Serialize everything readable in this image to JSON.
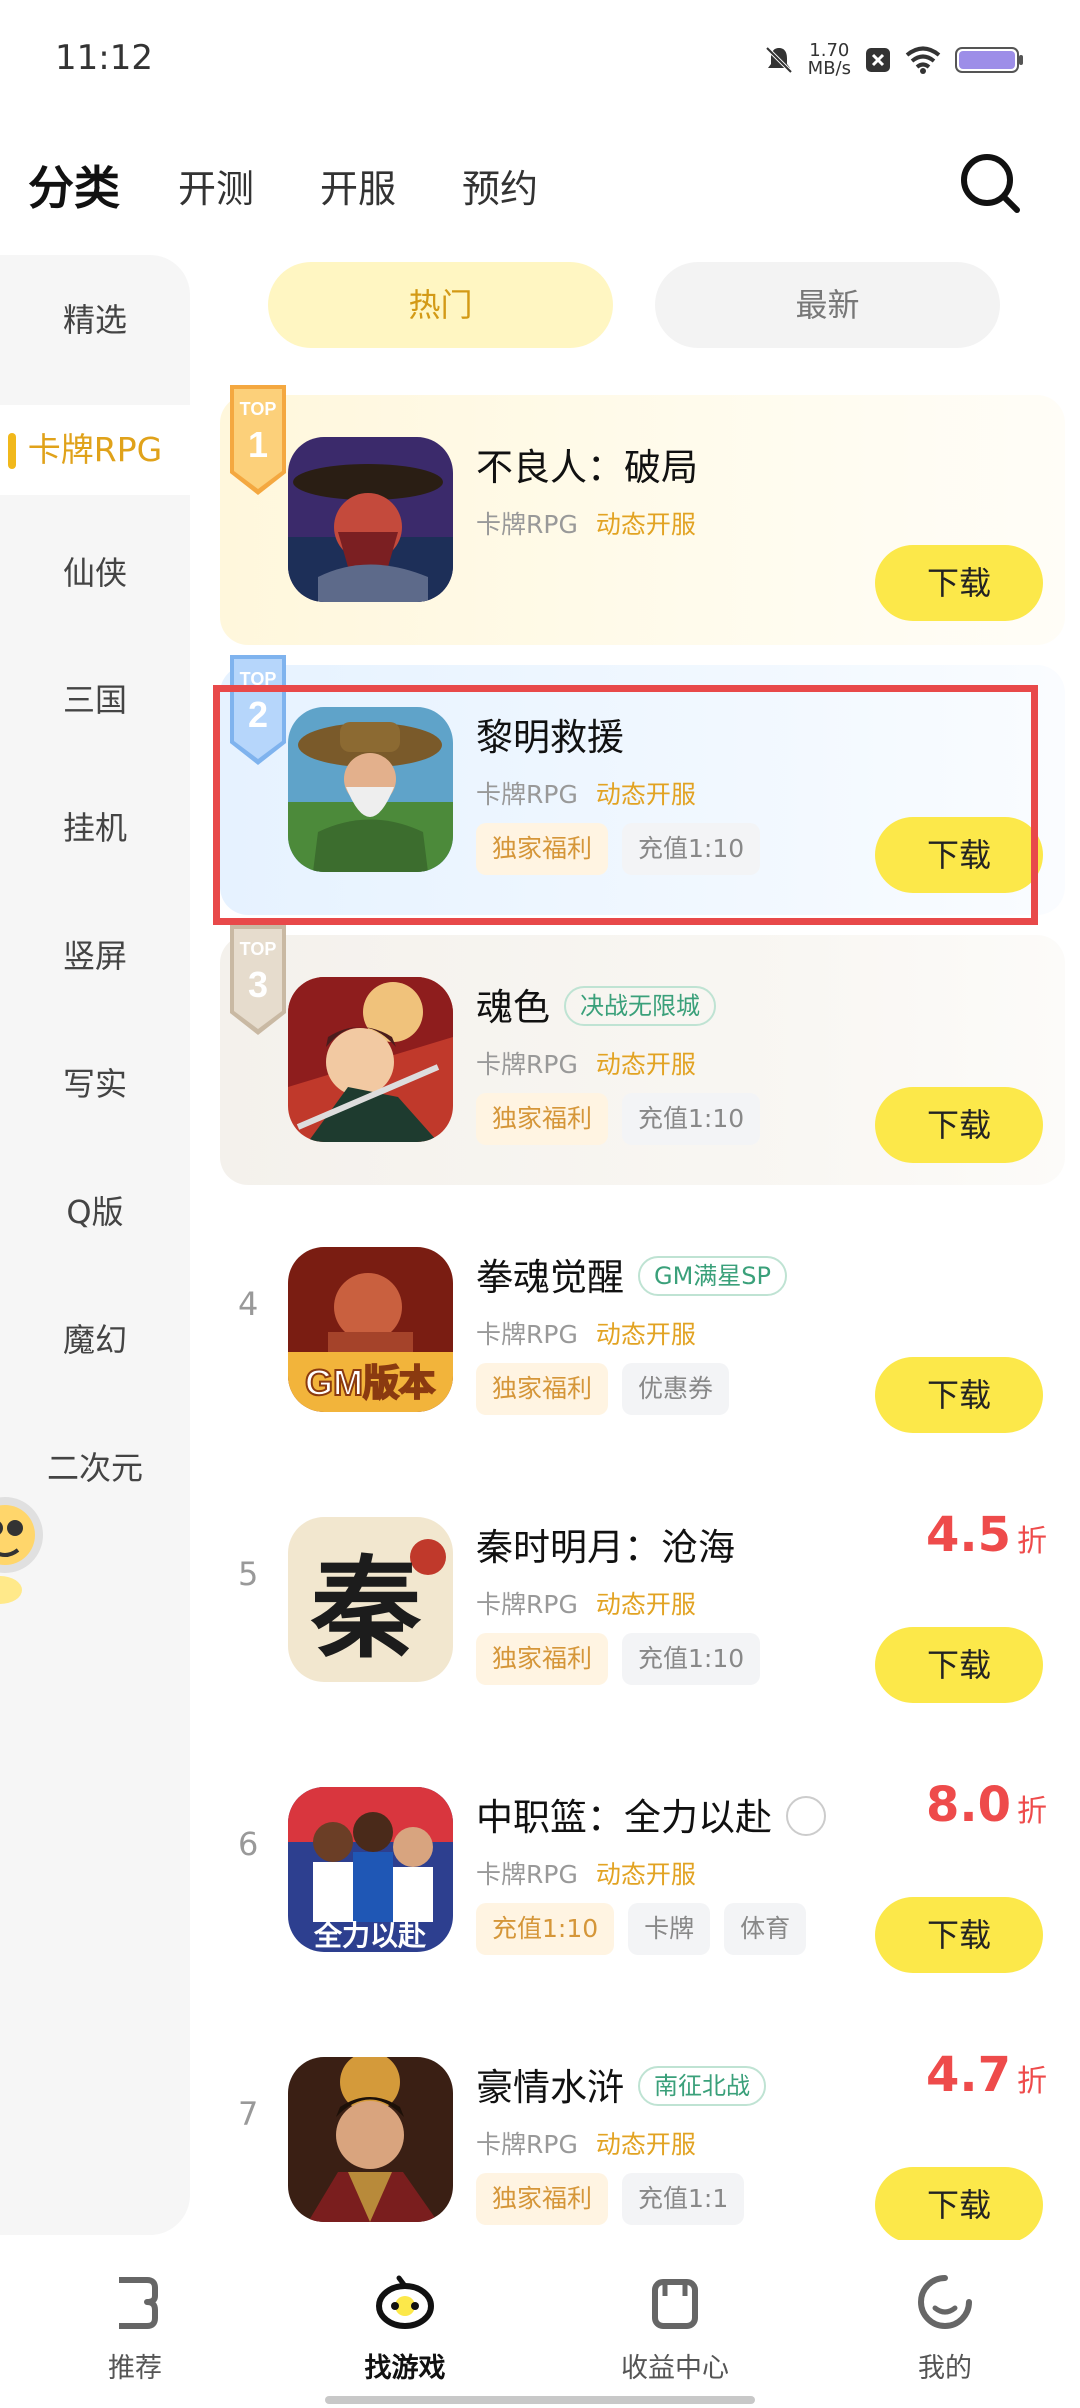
{
  "status_bar": {
    "time": "11:12",
    "speed_value": "1.70",
    "speed_unit": "MB/s"
  },
  "top_nav": {
    "tabs": [
      "分类",
      "开测",
      "开服",
      "预约"
    ],
    "active": "分类"
  },
  "sidebar": {
    "items": [
      "精选",
      "卡牌RPG",
      "仙侠",
      "三国",
      "挂机",
      "竖屏",
      "写实",
      "Q版",
      "魔幻",
      "二次元"
    ],
    "active": "卡牌RPG"
  },
  "sub_tabs": {
    "hot": "热门",
    "new": "最新"
  },
  "games": [
    {
      "rank": "1",
      "badge_top": "TOP",
      "title": "不良人：破局",
      "tag": "",
      "category": "卡牌RPG",
      "service": "动态开服",
      "perks": [],
      "discount": "",
      "discount_unit": "",
      "button": "下载"
    },
    {
      "rank": "2",
      "badge_top": "TOP",
      "title": "黎明救援",
      "tag": "",
      "category": "卡牌RPG",
      "service": "动态开服",
      "perks": [
        "独家福利",
        "充值1:10"
      ],
      "discount": "",
      "discount_unit": "",
      "button": "下载"
    },
    {
      "rank": "3",
      "badge_top": "TOP",
      "title": "魂色",
      "tag": "决战无限城",
      "category": "卡牌RPG",
      "service": "动态开服",
      "perks": [
        "独家福利",
        "充值1:10"
      ],
      "discount": "",
      "discount_unit": "",
      "button": "下载"
    },
    {
      "rank": "4",
      "title": "拳魂觉醒",
      "tag": "GM满星SP",
      "category": "卡牌RPG",
      "service": "动态开服",
      "perks": [
        "独家福利",
        "优惠券"
      ],
      "discount": "",
      "discount_unit": "",
      "button": "下载",
      "icon_text": "GM版本"
    },
    {
      "rank": "5",
      "title": "秦时明月：沧海",
      "tag": "",
      "category": "卡牌RPG",
      "service": "动态开服",
      "perks": [
        "独家福利",
        "充值1:10"
      ],
      "discount": "4.5",
      "discount_unit": "折",
      "button": "下载",
      "icon_text": "秦"
    },
    {
      "rank": "6",
      "title": "中职篮：全力以赴",
      "tag": "",
      "category": "卡牌RPG",
      "service": "动态开服",
      "perks": [
        "充值1:10",
        "卡牌",
        "体育"
      ],
      "discount": "8.0",
      "discount_unit": "折",
      "button": "下载",
      "icon_text": "全力以赴"
    },
    {
      "rank": "7",
      "title": "豪情水浒",
      "tag": "南征北战",
      "category": "卡牌RPG",
      "service": "动态开服",
      "perks": [
        "独家福利",
        "充值1:1"
      ],
      "discount": "4.7",
      "discount_unit": "折",
      "button": "下载"
    }
  ],
  "bottom_nav": {
    "items": [
      "推荐",
      "找游戏",
      "收益中心",
      "我的"
    ],
    "active": "找游戏"
  },
  "colors": {
    "accent_yellow": "#fce84a",
    "sidebar_active": "#e0a21a",
    "discount_red": "#ee4b4b",
    "highlight_red": "#e8494a"
  }
}
